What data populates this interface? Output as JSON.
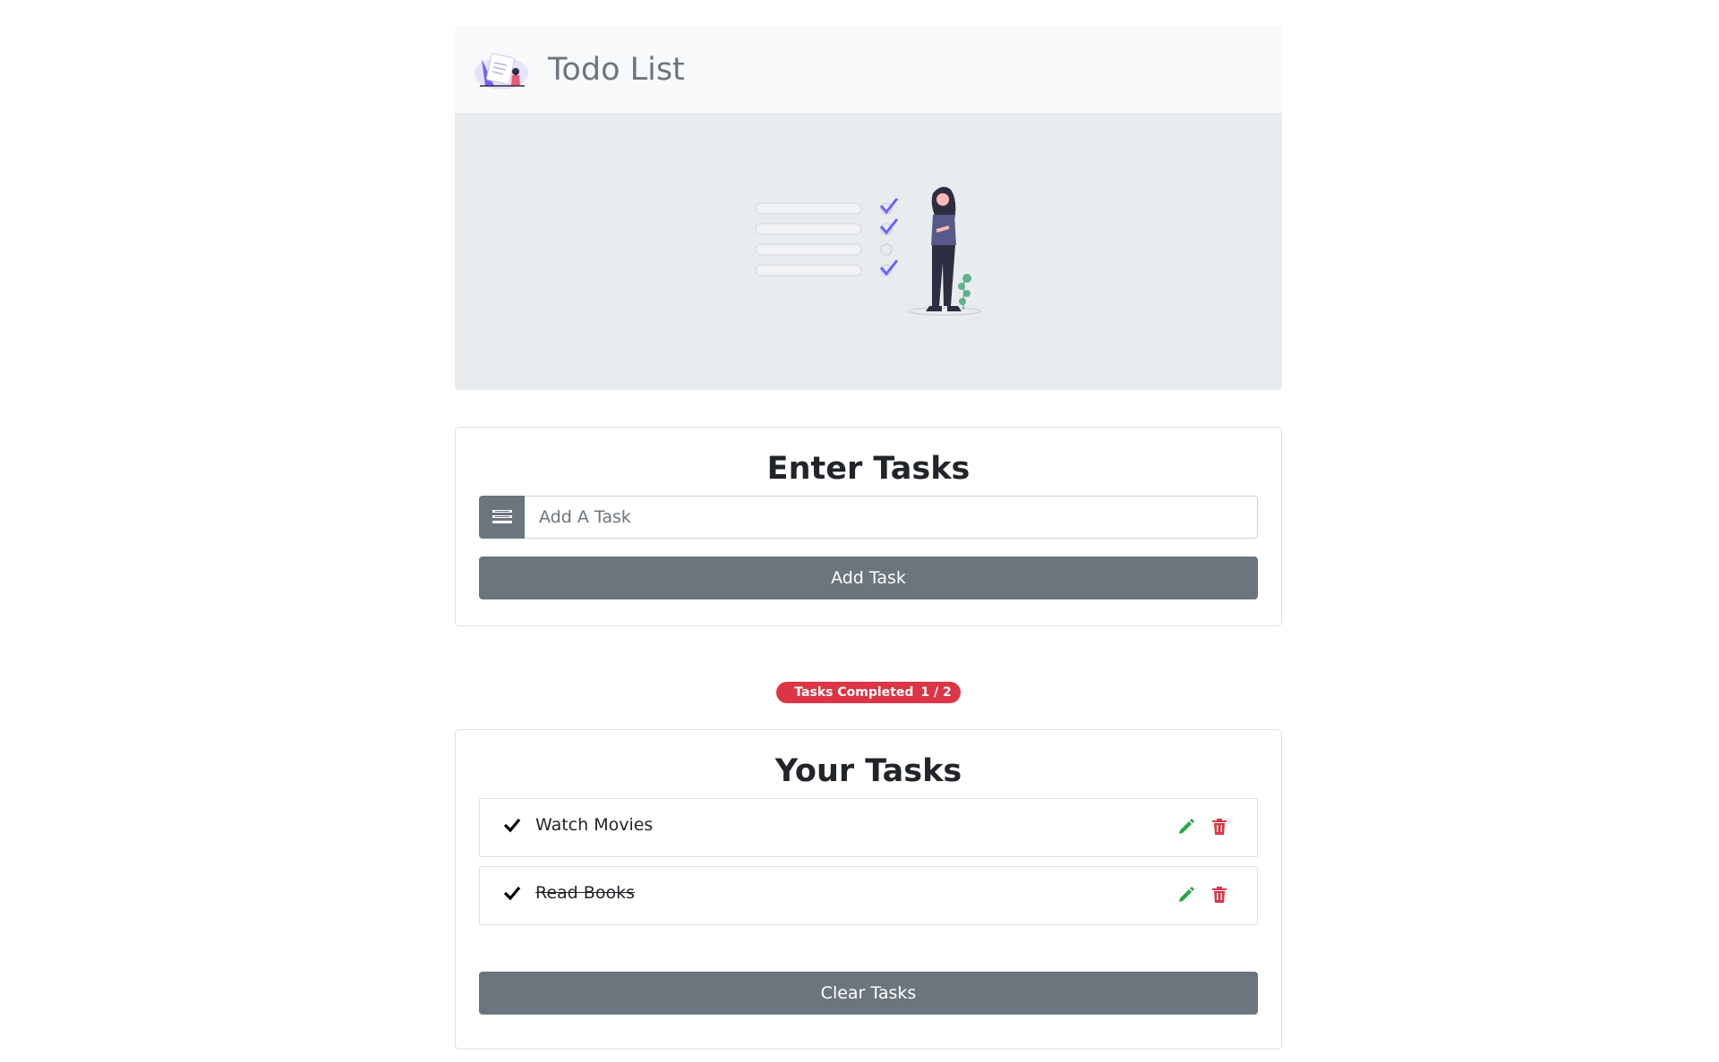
{
  "navbar": {
    "title": "Todo List",
    "logo_icon": "todo-illustration-logo-icon"
  },
  "hero": {
    "illustration_icon": "checklist-person-illustration"
  },
  "enter_card": {
    "title": "Enter Tasks",
    "input": {
      "value": "",
      "placeholder": "Add A Task",
      "icon": "list-icon"
    },
    "add_button_label": "Add Task"
  },
  "status": {
    "badge_label": "Tasks Completed",
    "completed": 1,
    "total": 2,
    "count_text": "1 / 2"
  },
  "tasks_card": {
    "title": "Your Tasks",
    "tasks": [
      {
        "label": "Watch Movies",
        "completed": false,
        "check_icon": "check-icon",
        "edit_icon": "pencil-icon",
        "delete_icon": "trash-icon"
      },
      {
        "label": "Read Books",
        "completed": true,
        "check_icon": "check-icon",
        "edit_icon": "pencil-icon",
        "delete_icon": "trash-icon"
      }
    ],
    "clear_button_label": "Clear Tasks"
  },
  "colors": {
    "navbar_bg": "#f8f9fa",
    "hero_bg": "#e9ecef",
    "secondary": "#6c757d",
    "danger": "#dc3545",
    "success": "#28a745",
    "accent_purple": "#6c63ff"
  }
}
